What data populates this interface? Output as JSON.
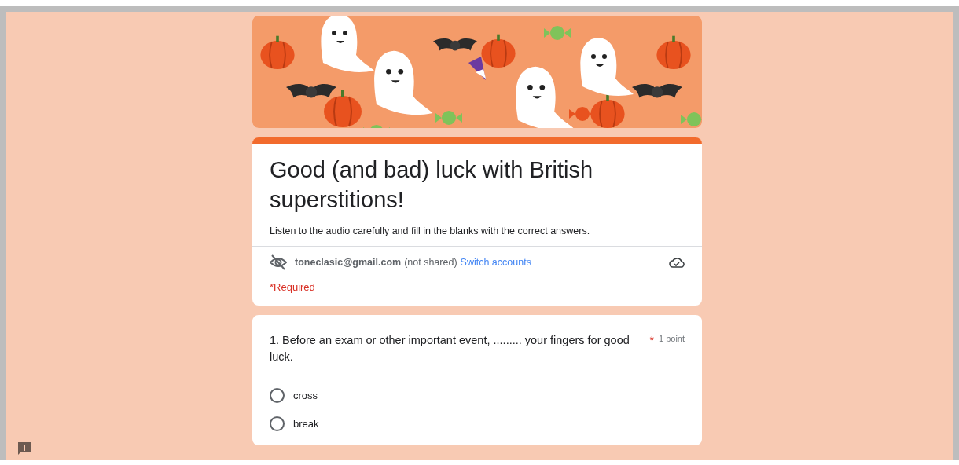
{
  "form": {
    "title": "Good (and bad) luck with British superstitions!",
    "description": "Listen to the audio carefully and fill in the blanks with the correct answers.",
    "account": {
      "email": "toneclasic@gmail.com",
      "note": "(not shared)",
      "switch_link": "Switch accounts"
    },
    "required_note": "*Required"
  },
  "questions": [
    {
      "text": "1. Before an exam or other important event, ......... your fingers for good luck.",
      "required": true,
      "required_mark": "*",
      "points": "1 point",
      "options": [
        {
          "label": "cross",
          "selected": false
        },
        {
          "label": "break",
          "selected": false
        }
      ]
    }
  ]
}
